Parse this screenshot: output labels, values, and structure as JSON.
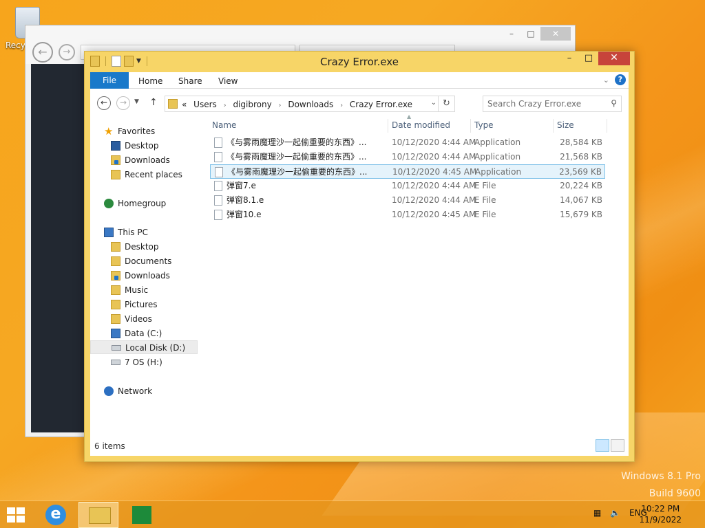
{
  "desktop": {
    "recycle_label": "Recyc",
    "watermark_line1": "Windows 8.1 Pro",
    "watermark_line2": "Build 9600"
  },
  "window": {
    "title": "Crazy Error.exe",
    "caption_min": "–",
    "caption_max": "□",
    "caption_close": "✕",
    "accent": "#f7d567",
    "close_color": "#c7443b"
  },
  "ribbon": {
    "file": "File",
    "home": "Home",
    "share": "Share",
    "view": "View",
    "file_color": "#1979ca"
  },
  "address": {
    "overflow": "«",
    "crumbs": [
      "Users",
      "digibrony",
      "Downloads",
      "Crazy Error.exe"
    ],
    "search_placeholder": "Search Crazy Error.exe"
  },
  "navpane": {
    "favorites": "Favorites",
    "desktop": "Desktop",
    "downloads": "Downloads",
    "recent": "Recent places",
    "homegroup": "Homegroup",
    "thispc": "This PC",
    "pc_desktop": "Desktop",
    "documents": "Documents",
    "pc_downloads": "Downloads",
    "music": "Music",
    "pictures": "Pictures",
    "videos": "Videos",
    "data_c": "Data (C:)",
    "local_d": "Local Disk (D:)",
    "os_h": "7 OS (H:)",
    "network": "Network"
  },
  "columns": {
    "name": "Name",
    "date": "Date modified",
    "type": "Type",
    "size": "Size"
  },
  "files": [
    {
      "name": "《与雾雨魔理沙一起偷重要的东西》...",
      "date": "10/12/2020 4:44 AM",
      "type": "Application",
      "size": "28,584 KB"
    },
    {
      "name": "《与雾雨魔理沙一起偷重要的东西》...",
      "date": "10/12/2020 4:44 AM",
      "type": "Application",
      "size": "21,568 KB"
    },
    {
      "name": "《与雾雨魔理沙一起偷重要的东西》...",
      "date": "10/12/2020 4:45 AM",
      "type": "Application",
      "size": "23,569 KB"
    },
    {
      "name": "弹窗7.e",
      "date": "10/12/2020 4:44 AM",
      "type": "E File",
      "size": "20,224 KB"
    },
    {
      "name": "弹窗8.1.e",
      "date": "10/12/2020 4:44 AM",
      "type": "E File",
      "size": "14,067 KB"
    },
    {
      "name": "弹窗10.e",
      "date": "10/12/2020 4:45 AM",
      "type": "E File",
      "size": "15,679 KB"
    }
  ],
  "status": {
    "count": "6 items"
  },
  "taskbar": {
    "ie_glyph": "e",
    "language": "ENG",
    "time": "10:22 PM",
    "date": "11/9/2022"
  }
}
